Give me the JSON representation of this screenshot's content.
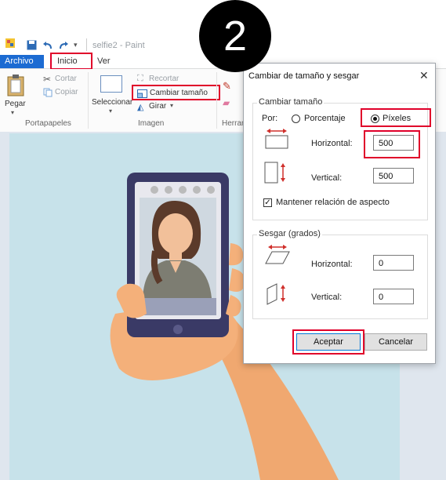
{
  "window": {
    "title": "selfie2 - Paint"
  },
  "menu": {
    "file": "Archivo",
    "home": "Inicio",
    "view": "Ver"
  },
  "ribbon": {
    "clipboard": {
      "paste": "Pegar",
      "cut": "Cortar",
      "copy": "Copiar",
      "group": "Portapapeles"
    },
    "image": {
      "select": "Seleccionar",
      "crop": "Recortar",
      "resize": "Cambiar tamaño",
      "rotate": "Girar",
      "group": "Imagen"
    },
    "tools": {
      "group": "Herran"
    }
  },
  "step_badge": "2",
  "dialog": {
    "title": "Cambiar de tamaño y sesgar",
    "resize_section": "Cambiar tamaño",
    "by_label": "Por:",
    "percent_option": "Porcentaje",
    "pixels_option": "Píxeles",
    "selected_unit": "Píxeles",
    "horizontal_label": "Horizontal:",
    "vertical_label": "Vertical:",
    "horizontal_value": "500",
    "vertical_value": "500",
    "keep_ratio_label": "Mantener relación de aspecto",
    "keep_ratio_checked": true,
    "skew_section": "Sesgar (grados)",
    "skew_horizontal_label": "Horizontal:",
    "skew_vertical_label": "Vertical:",
    "skew_horizontal_value": "0",
    "skew_vertical_value": "0",
    "ok": "Aceptar",
    "cancel": "Cancelar"
  },
  "colors": {
    "accent": "#1c6bd2",
    "highlight": "#e0002a",
    "canvas_bg": "#c7e2ea",
    "phone": "#3a3a66"
  }
}
